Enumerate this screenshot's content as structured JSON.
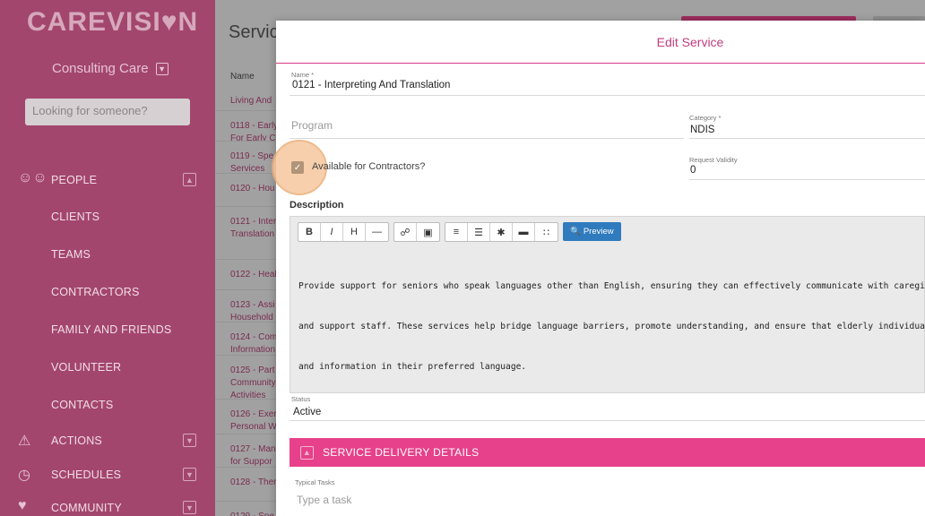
{
  "sidebar": {
    "logo": "CAREVISI♥N",
    "org": "Consulting Care",
    "search_placeholder": "Looking for someone?",
    "people_label": "PEOPLE",
    "items": [
      "CLIENTS",
      "TEAMS",
      "CONTRACTORS",
      "FAMILY AND FRIENDS",
      "VOLUNTEER",
      "CONTACTS"
    ],
    "actions_label": "ACTIONS",
    "schedules_label": "SCHEDULES",
    "community_label": "COMMUNITY"
  },
  "list": {
    "title": "Servic",
    "header": "Name",
    "rows": [
      [
        "Living And"
      ],
      [
        "0118 - Early",
        "For Early C"
      ],
      [
        "0119 - Spe",
        "Services"
      ],
      [
        "0120 - Hou"
      ],
      [
        "0121 - Inter",
        "Translation"
      ],
      [
        "0122 - Heal"
      ],
      [
        "0123 - Assi",
        "Household"
      ],
      [
        "0124 - Com",
        "Information"
      ],
      [
        "0125 - Part",
        "Community",
        "Activities"
      ],
      [
        "0126 - Exer",
        "Personal W"
      ],
      [
        "0127 - Man",
        "for Suppor"
      ],
      [
        "0128 - Ther"
      ],
      [
        "0129 - Spe"
      ]
    ]
  },
  "modal": {
    "title": "Edit Service",
    "name_label": "Name *",
    "name_value": "0121 - Interpreting And Translation",
    "program_placeholder": "Program",
    "category_label": "Category *",
    "category_value": "NDIS",
    "available_label": "Available for Contractors?",
    "available_checked": true,
    "validity_label": "Request Validity",
    "validity_value": "0",
    "description_title": "Description",
    "toolbar": {
      "bold": "B",
      "italic": "I",
      "heading": "H",
      "rule": "—",
      "link": "🔗",
      "image": "▣",
      "ol": "≡",
      "ul": "☰",
      "asterisk": "✱",
      "comment": "▬",
      "grid": "∷",
      "preview": "Preview"
    },
    "description_lines": [
      "Provide support for seniors who speak languages other than English, ensuring they can effectively communicate with caregiv",
      "and support staff. These services help bridge language barriers, promote understanding, and ensure that elderly individual",
      "and information in their preferred language."
    ],
    "status_label": "Status",
    "status_value": "Active",
    "section_title": "SERVICE DELIVERY DETAILS",
    "typical_tasks_label": "Typical Tasks",
    "typical_tasks_placeholder": "Type a task"
  },
  "colors": {
    "sidebar": "#a3466e",
    "accent": "#e6418a",
    "preview": "#2f7bbd"
  }
}
